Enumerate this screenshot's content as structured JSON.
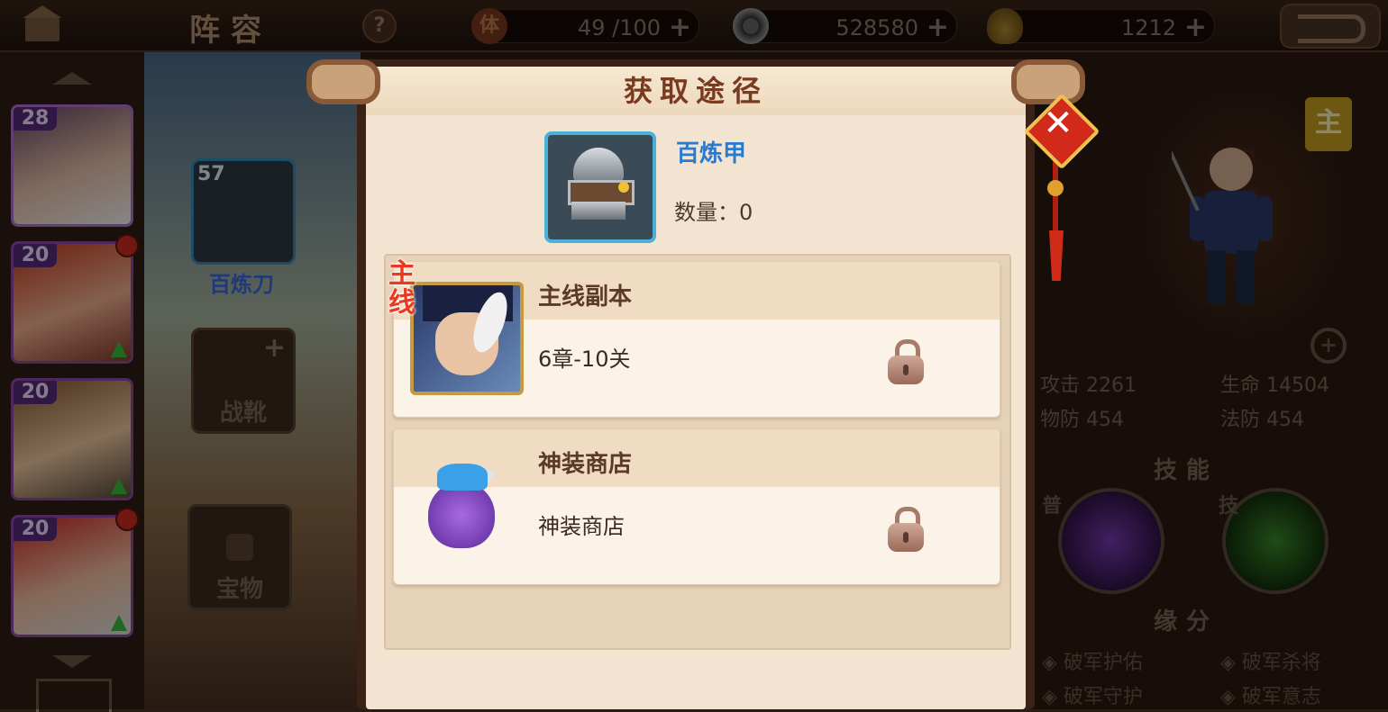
{
  "topbar": {
    "title": "阵容",
    "help_label": "?",
    "stamina": {
      "icon_char": "体",
      "value": "49 /100",
      "plus": "+"
    },
    "coins": {
      "value": "528580",
      "plus": "+"
    },
    "ingots": {
      "value": "1212",
      "plus": "+"
    }
  },
  "roster": {
    "heroes": [
      {
        "level": "28",
        "selected": true
      },
      {
        "level": "20",
        "notify": true,
        "upgrade": true
      },
      {
        "level": "20",
        "upgrade": true
      },
      {
        "level": "20",
        "notify": true,
        "upgrade": true
      }
    ]
  },
  "equipment": {
    "weapon": {
      "level": "57",
      "name": "百炼刀"
    },
    "boots": {
      "label": "战靴",
      "plus": "+"
    },
    "treasure": {
      "label": "宝物"
    }
  },
  "character": {
    "badge": "主",
    "stats": [
      {
        "text": "攻击 2261"
      },
      {
        "text": "生命 14504"
      },
      {
        "text": "物防 454"
      },
      {
        "text": "法防 454"
      }
    ],
    "skills_header": "技能",
    "skill_tags": {
      "normal": "普",
      "special": "技"
    },
    "fate_header": "缘分",
    "fates": [
      "◈ 破军护佑",
      "◈ 破军杀将",
      "◈ 破军守护",
      "◈ 破军意志"
    ]
  },
  "dialog": {
    "title": "获取途径",
    "close_label": "✕",
    "item": {
      "name": "百炼甲",
      "quantity": "数量：0"
    },
    "sources": [
      {
        "name": "主线副本",
        "description": "6章-10关",
        "tag": "主线",
        "locked": true
      },
      {
        "name": "神装商店",
        "description": "神装商店",
        "locked": true
      }
    ]
  },
  "colors": {
    "dialog_paper": "#f2e4d0",
    "title_text": "#7a3a20",
    "item_name": "#2a7ad0",
    "close_red": "#d22a1a",
    "hero_frame_purple": "#8a4aa8"
  }
}
